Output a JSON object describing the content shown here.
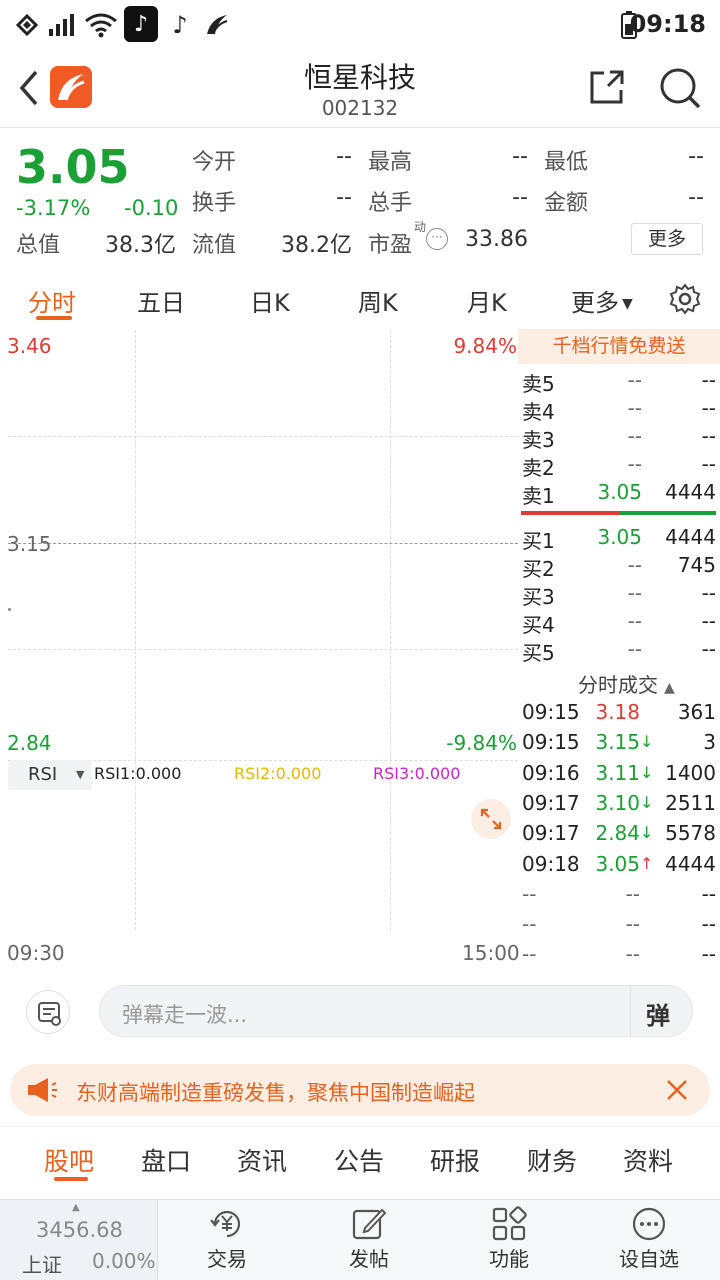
{
  "status": {
    "time": "09:18"
  },
  "header": {
    "title": "恒星科技",
    "code": "002132"
  },
  "quote": {
    "price": "3.05",
    "change_pct": "-3.17%",
    "change": "-0.10",
    "open_label": "今开",
    "open_val": "--",
    "high_label": "最高",
    "high_val": "--",
    "low_label": "最低",
    "low_val": "--",
    "turnover_label": "换手",
    "turnover_val": "--",
    "volume_label": "总手",
    "volume_val": "--",
    "amount_label": "金额",
    "amount_val": "--",
    "mktcap_label": "总值",
    "mktcap_val": "38.3亿",
    "float_label": "流值",
    "float_val": "38.2亿",
    "pe_label": "市盈",
    "pe_sup": "动",
    "pe_val": "33.86",
    "more_label": "更多"
  },
  "chart_tabs": [
    "分时",
    "五日",
    "日K",
    "周K",
    "月K",
    "更多"
  ],
  "chart": {
    "top_price": "3.46",
    "top_pct": "9.84%",
    "mid_price": "3.15",
    "bottom_price": "2.84",
    "bottom_pct": "-9.84%",
    "indicator": "RSI",
    "rsi1": "RSI1:0.000",
    "rsi2": "RSI2:0.000",
    "rsi3": "RSI3:0.000",
    "time_start": "09:30",
    "time_end": "15:00"
  },
  "orderbook": {
    "promo": "千档行情免费送",
    "sells": [
      {
        "label": "卖5",
        "price": "--",
        "vol": "--"
      },
      {
        "label": "卖4",
        "price": "--",
        "vol": "--"
      },
      {
        "label": "卖3",
        "price": "--",
        "vol": "--"
      },
      {
        "label": "卖2",
        "price": "--",
        "vol": "--"
      },
      {
        "label": "卖1",
        "price": "3.05",
        "vol": "4444"
      }
    ],
    "buys": [
      {
        "label": "买1",
        "price": "3.05",
        "vol": "4444"
      },
      {
        "label": "买2",
        "price": "--",
        "vol": "745"
      },
      {
        "label": "买3",
        "price": "--",
        "vol": "--"
      },
      {
        "label": "买4",
        "price": "--",
        "vol": "--"
      },
      {
        "label": "买5",
        "price": "--",
        "vol": "--"
      }
    ],
    "ticks_title": "分时成交",
    "ticks": [
      {
        "time": "09:15",
        "price": "3.18",
        "arrow": "",
        "vol": "361",
        "color": "red"
      },
      {
        "time": "09:15",
        "price": "3.15",
        "arrow": "↓",
        "vol": "3",
        "color": "green"
      },
      {
        "time": "09:16",
        "price": "3.11",
        "arrow": "↓",
        "vol": "1400",
        "color": "green"
      },
      {
        "time": "09:17",
        "price": "3.10",
        "arrow": "↓",
        "vol": "2511",
        "color": "green"
      },
      {
        "time": "09:17",
        "price": "2.84",
        "arrow": "↓",
        "vol": "5578",
        "color": "green"
      },
      {
        "time": "09:18",
        "price": "3.05",
        "arrow": "↑",
        "vol": "4444",
        "color": "green"
      },
      {
        "time": "--",
        "price": "--",
        "arrow": "",
        "vol": "--",
        "color": "gray"
      },
      {
        "time": "--",
        "price": "--",
        "arrow": "",
        "vol": "--",
        "color": "gray"
      },
      {
        "time": "--",
        "price": "--",
        "arrow": "",
        "vol": "--",
        "color": "gray"
      }
    ]
  },
  "danmu": {
    "placeholder": "弹幕走一波...",
    "btn": "弹"
  },
  "banner": {
    "text": "东财高端制造重磅发售，聚焦中国制造崛起"
  },
  "bottom_tabs": [
    "股吧",
    "盘口",
    "资讯",
    "公告",
    "研报",
    "财务",
    "资料"
  ],
  "index": {
    "value": "3456.68",
    "name": "上证",
    "pct": "0.00%"
  },
  "nav": [
    "交易",
    "发帖",
    "功能",
    "设自选"
  ],
  "colors": {
    "accent": "#e8611f",
    "up": "#e03c31",
    "down": "#1aa034"
  }
}
